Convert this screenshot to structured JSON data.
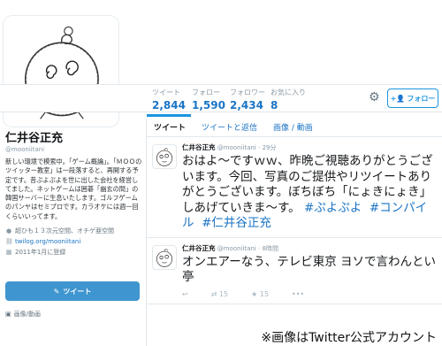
{
  "profile": {
    "name": "仁井谷正充",
    "handle": "@mooniitani",
    "bio": "新しい環境で模索中。「ゲーム概論」。「ＭＯＯのツイッター教室」は一段落すると、再開する予定です。昔ぷよぷよを世に出した会社を経営してました。ネットゲームは囲碁「幽玄の間」の韓国サーバーに生息いたします。ゴルフゲームのパンヤはセミプロです。カラオケには週一回くらいいってます。",
    "location": "超ひも１３次元空間、オチゲ亜空間",
    "url": "twilog.org/mooniitani",
    "joined": "2011年1月に登録",
    "tweet_button": "ツイート",
    "media_link": "画像/動画"
  },
  "stats": [
    {
      "label": "ツイート",
      "value": "2,844"
    },
    {
      "label": "フォロー",
      "value": "1,590"
    },
    {
      "label": "フォロワー",
      "value": "2,434"
    },
    {
      "label": "お気に入り",
      "value": "8"
    }
  ],
  "follow_label": "フォロー",
  "tabs": [
    "ツイート",
    "ツイートと返信",
    "画像 / 動画"
  ],
  "tweets": [
    {
      "name": "仁井谷正充",
      "handle": "@mooniitani",
      "time": "29分",
      "text": "おはよ～ですｗｗ、昨晩ご視聴ありがとうございます。今回、写真のご提供やリツイートありがとうございます。ぼちぼち「にょきにょき」しあげていきま～す。",
      "tags": [
        "#ぷよぷよ",
        "#コンパイル",
        "#仁井谷正充"
      ]
    },
    {
      "name": "仁井谷正充",
      "handle": "@mooniitani",
      "time": "8時間",
      "text": "オンエアーなう、テレビ東京 ヨソで言わんとい亭",
      "retweets": "15",
      "favorites": "15"
    }
  ],
  "watermark": "※画像はTwitter公式アカウント"
}
